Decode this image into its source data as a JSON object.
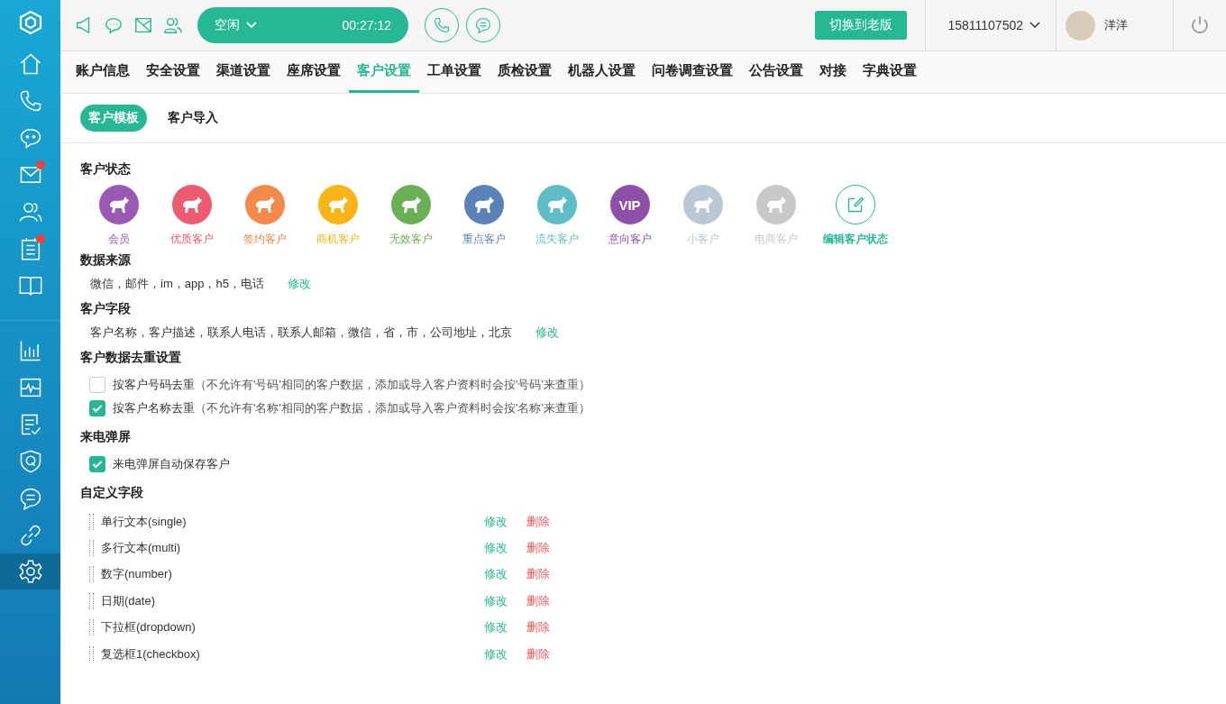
{
  "sidebar": {
    "items": [
      {
        "kind": "home",
        "badge": false,
        "selected": false
      },
      {
        "kind": "phone",
        "badge": false,
        "selected": false
      },
      {
        "kind": "chat",
        "badge": false,
        "selected": false
      },
      {
        "kind": "mail",
        "badge": true,
        "selected": false
      },
      {
        "kind": "contacts",
        "badge": false,
        "selected": false
      },
      {
        "kind": "notes",
        "badge": true,
        "selected": false
      },
      {
        "kind": "book",
        "badge": false,
        "selected": false
      },
      {
        "kind": "chart",
        "badge": false,
        "selected": false
      },
      {
        "kind": "monitor",
        "badge": false,
        "selected": false
      },
      {
        "kind": "checklist",
        "badge": false,
        "selected": false
      },
      {
        "kind": "shield",
        "badge": false,
        "selected": false
      },
      {
        "kind": "message",
        "badge": false,
        "selected": false
      },
      {
        "kind": "link",
        "badge": false,
        "selected": false
      },
      {
        "kind": "settings",
        "badge": false,
        "selected": true
      }
    ]
  },
  "topbar": {
    "status": "空闲",
    "timer": "00:27:12",
    "switch_button": "切换到老版",
    "account": "15811107502",
    "user_name": "洋洋"
  },
  "tabs": [
    {
      "label": "账户信息",
      "selected": false
    },
    {
      "label": "安全设置",
      "selected": false
    },
    {
      "label": "渠道设置",
      "selected": false
    },
    {
      "label": "座席设置",
      "selected": false
    },
    {
      "label": "客户设置",
      "selected": true
    },
    {
      "label": "工单设置",
      "selected": false
    },
    {
      "label": "质检设置",
      "selected": false
    },
    {
      "label": "机器人设置",
      "selected": false
    },
    {
      "label": "问卷调查设置",
      "selected": false
    },
    {
      "label": "公告设置",
      "selected": false
    },
    {
      "label": "对接",
      "selected": false
    },
    {
      "label": "字典设置",
      "selected": false
    }
  ],
  "subtabs": [
    {
      "label": "客户模板",
      "selected": true
    },
    {
      "label": "客户导入",
      "selected": false
    }
  ],
  "customer_status": {
    "title": "客户状态",
    "items": [
      {
        "label": "会员",
        "color": "#9b59b6",
        "kind": "animal"
      },
      {
        "label": "优质客户",
        "color": "#ee5a6f",
        "kind": "animal"
      },
      {
        "label": "签约客户",
        "color": "#f4894b",
        "kind": "animal"
      },
      {
        "label": "商机客户",
        "color": "#f9b516",
        "kind": "animal"
      },
      {
        "label": "无效客户",
        "color": "#6aae55",
        "kind": "animal"
      },
      {
        "label": "重点客户",
        "color": "#5a82b8",
        "kind": "animal"
      },
      {
        "label": "流失客户",
        "color": "#5fbdc8",
        "kind": "animal"
      },
      {
        "label": "意向客户",
        "color": "#8e4fa8",
        "kind": "text",
        "glyph": "VIP"
      },
      {
        "label": "小客户",
        "color": "#b9c8d4",
        "kind": "animal"
      },
      {
        "label": "电商客户",
        "color": "#c8c8c8",
        "kind": "animal"
      }
    ],
    "edit": "编辑客户状态"
  },
  "data_source": {
    "title": "数据来源",
    "value": "微信，邮件，im，app，h5，电话",
    "action": "修改"
  },
  "customer_fields": {
    "title": "客户字段",
    "value": "客户名称，客户描述，联系人电话，联系人邮箱，微信，省，市，公司地址，北京",
    "action": "修改"
  },
  "dedup": {
    "title": "客户数据去重设置",
    "options": [
      {
        "label": "按客户号码去重",
        "note": "（不允许有'号码'相同的客户数据，添加或导入客户资料时会按'号码'来查重）",
        "checked": false
      },
      {
        "label": "按客户名称去重",
        "note": "（不允许有'名称'相同的客户数据，添加或导入客户资料时会按'名称'来查重）",
        "checked": true
      }
    ]
  },
  "screen_pop": {
    "title": "来电弹屏",
    "options": [
      {
        "label": "来电弹屏自动保存客户",
        "checked": true
      }
    ]
  },
  "custom_fields": {
    "title": "自定义字段",
    "rows": [
      {
        "name": "单行文本(single)",
        "edit": "修改",
        "delete": "删除"
      },
      {
        "name": "多行文本(multi)",
        "edit": "修改",
        "delete": "删除"
      },
      {
        "name": "数字(number)",
        "edit": "修改",
        "delete": "删除"
      },
      {
        "name": "日期(date)",
        "edit": "修改",
        "delete": "删除"
      },
      {
        "name": "下拉框(dropdown)",
        "edit": "修改",
        "delete": "删除"
      },
      {
        "name": "复选框1(checkbox)",
        "edit": "修改",
        "delete": "删除"
      }
    ]
  }
}
